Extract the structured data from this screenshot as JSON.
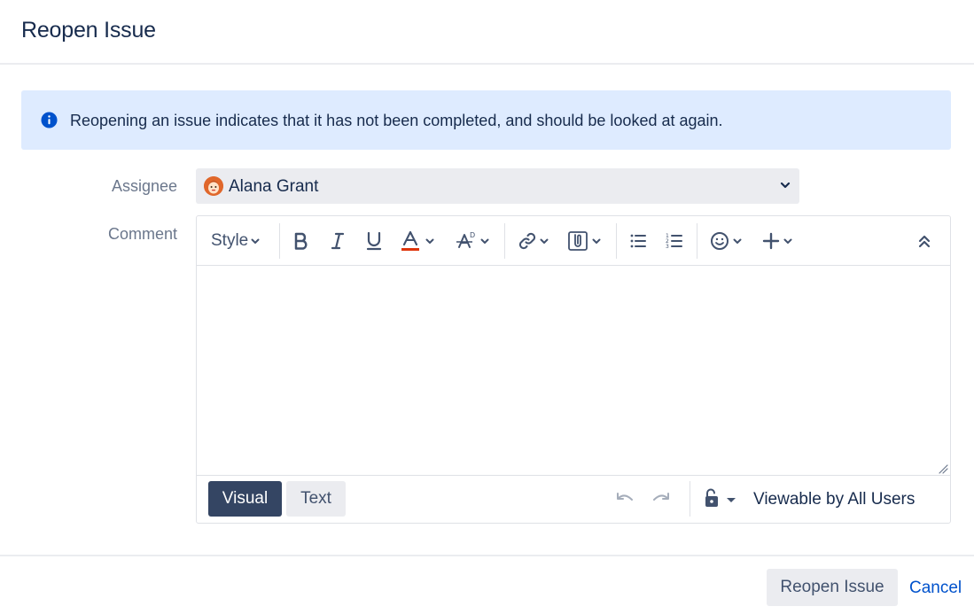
{
  "dialog": {
    "title": "Reopen Issue"
  },
  "info": {
    "message": "Reopening an issue indicates that it has not been completed, and should be looked at again.",
    "icon": "info-icon",
    "background": "#deebff",
    "icon_color": "#0052cc"
  },
  "assignee": {
    "label": "Assignee",
    "value": "Alana Grant",
    "avatar_color": "#e0672b"
  },
  "comment": {
    "label": "Comment",
    "toolbar": {
      "style_label": "Style",
      "buttons": [
        "bold-icon",
        "italic-icon",
        "underline-icon",
        "text-color-icon",
        "text-effects-icon",
        "link-icon",
        "attachment-icon",
        "bullet-list-icon",
        "numbered-list-icon",
        "emoji-icon",
        "insert-plus-icon",
        "collapse-toolbar-icon"
      ],
      "text_color_underline": "#de350b"
    },
    "body": "",
    "modes": {
      "visual": "Visual",
      "text": "Text",
      "active": "Visual"
    },
    "visibility": "Viewable by All Users"
  },
  "footer": {
    "submit_label": "Reopen Issue",
    "cancel_label": "Cancel"
  },
  "colors": {
    "primary_dark": "#344563",
    "link": "#0052cc",
    "label_gray": "#6b778c"
  }
}
